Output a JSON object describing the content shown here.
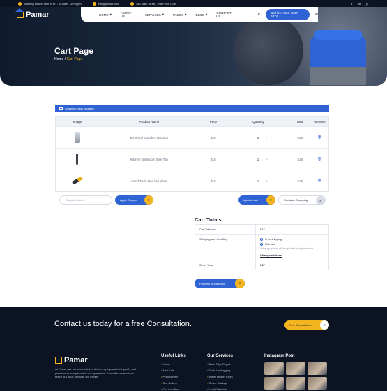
{
  "topbar": {
    "hours": "Working Hours: Mon to Fri - 9:00am - 10:00pm",
    "email": "info@pamar.com",
    "address": "156 Main Street, 2nd Floor, USA",
    "social": [
      "f",
      "t",
      "in",
      "p"
    ]
  },
  "brand": {
    "name": "Pamar",
    "accent": "#f5b51e",
    "primary": "#2f63d3",
    "dark": "#0c1424"
  },
  "nav": {
    "items": [
      "HOME",
      "ABOUT US",
      "SERVICES",
      "PAGES",
      "BLOG",
      "CONTACT US"
    ],
    "search_icon": "search-icon",
    "call_label": "Call Us: +163-6547-6874",
    "menu_icon": "hamburger-icon"
  },
  "hero": {
    "title": "Cart Page",
    "breadcrumb": {
      "home": "Home",
      "separator": "/",
      "current": "Cart Page"
    }
  },
  "notice": {
    "text": "Shipping costs updated."
  },
  "cart": {
    "columns": [
      "Image",
      "Product Name",
      "Price",
      "Quantity",
      "Total",
      "Remove"
    ],
    "rows": [
      {
        "product": "Electrical Switches Breaker",
        "price": "$18",
        "qty": "1",
        "total": "$18",
        "minus": "-",
        "plus": "+"
      },
      {
        "product": "Kitchen Bathroom Sink Tap",
        "price": "$18",
        "qty": "1",
        "total": "$18",
        "minus": "-",
        "plus": "+"
      },
      {
        "product": "Hand Tools Hex key Allen",
        "price": "$18",
        "qty": "1",
        "total": "$18",
        "minus": "-",
        "plus": "+"
      }
    ]
  },
  "actions": {
    "coupon_placeholder": "Coupon Code...",
    "apply_coupon": "Apply Coupon",
    "update_cart": "Update cart",
    "continue_shopping": "Continue Shopping",
    "arrow": "»"
  },
  "totals": {
    "title": "Cart Totals",
    "subtotal_label": "Cart Subtotal",
    "subtotal_value": "$47",
    "shipping_label": "Shipping and Handling",
    "free_shipping": "Free shipping",
    "flat_rate": "Flat rate",
    "shipping_note": "Shipping options will be updated during checkout.",
    "change_address": "Change address",
    "order_total_label": "Order Total",
    "order_total_value": "$47",
    "checkout": "Proceed to checkout"
  },
  "footer": {
    "cta": "Contact us today for a free Consultation.",
    "cta_button": "Free Consultation",
    "about": "At Pamar, we are committed to delivering unparalleled quality and precision in every facet of our operations. From the moment you reach out to us, through our expert.",
    "useful_title": "Useful Links",
    "useful_links": [
      "Home",
      "About Us",
      "Pricing Plan",
      "Our Gallery",
      "Our Location"
    ],
    "services_title": "Our Services",
    "services": [
      "Burst Pipe Repair",
      "Drain Unclogging",
      "Water Heater Fixes",
      "Sewer Backup",
      "Leak Detection"
    ],
    "insta_title": "Instagram Post"
  }
}
